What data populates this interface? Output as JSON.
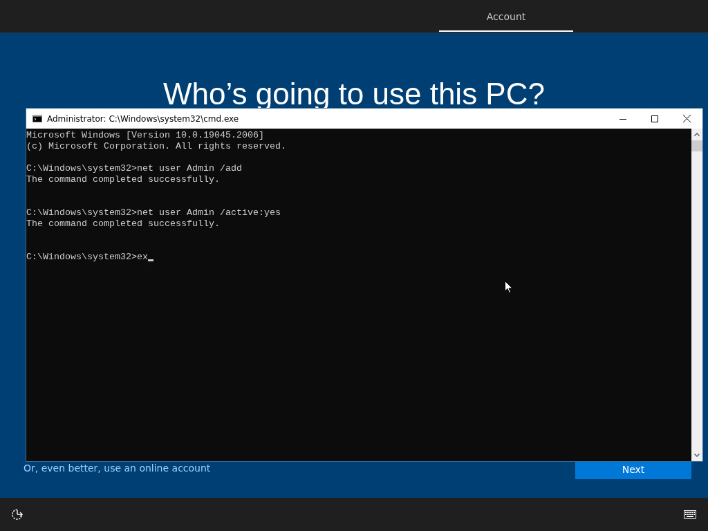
{
  "header": {
    "tabs": [
      {
        "label": "Account",
        "selected": true
      }
    ]
  },
  "heading": "Who’s going to use this PC?",
  "cmd_window": {
    "title": "Administrator: C:\\Windows\\system32\\cmd.exe",
    "lines": [
      {
        "kind": "text",
        "text": "Microsoft Windows [Version 10.0.19045.2006]"
      },
      {
        "kind": "text",
        "text": "(c) Microsoft Corporation. All rights reserved."
      },
      {
        "kind": "blank"
      },
      {
        "kind": "text",
        "text": "C:\\Windows\\system32>net user Admin /add"
      },
      {
        "kind": "text",
        "text": "The command completed successfully."
      },
      {
        "kind": "blank"
      },
      {
        "kind": "blank"
      },
      {
        "kind": "text",
        "text": "C:\\Windows\\system32>net user Admin /active:yes"
      },
      {
        "kind": "text",
        "text": "The command completed successfully."
      },
      {
        "kind": "blank"
      },
      {
        "kind": "blank"
      },
      {
        "kind": "prompt",
        "text": "C:\\Windows\\system32>ex"
      }
    ]
  },
  "online_account_link": "Or, even better, use an online account",
  "next_button": "Next"
}
